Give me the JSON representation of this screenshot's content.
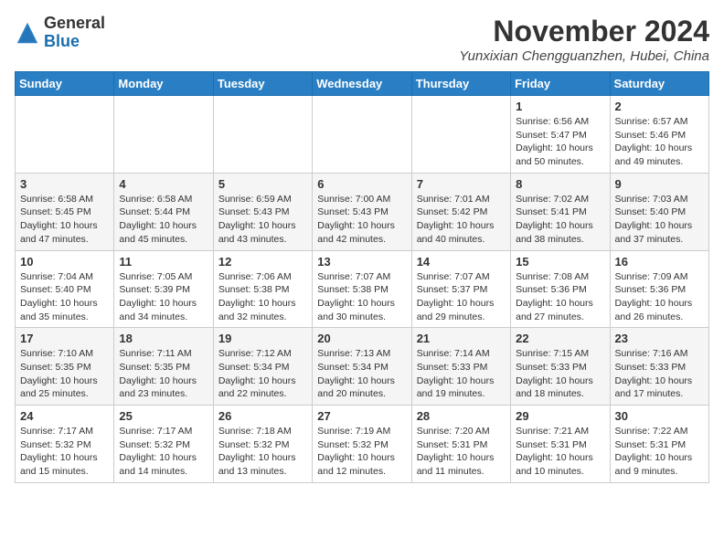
{
  "header": {
    "logo_line1": "General",
    "logo_line2": "Blue",
    "month_year": "November 2024",
    "location": "Yunxixian Chengguanzhen, Hubei, China"
  },
  "days_of_week": [
    "Sunday",
    "Monday",
    "Tuesday",
    "Wednesday",
    "Thursday",
    "Friday",
    "Saturday"
  ],
  "weeks": [
    [
      {
        "day": "",
        "info": ""
      },
      {
        "day": "",
        "info": ""
      },
      {
        "day": "",
        "info": ""
      },
      {
        "day": "",
        "info": ""
      },
      {
        "day": "",
        "info": ""
      },
      {
        "day": "1",
        "info": "Sunrise: 6:56 AM\nSunset: 5:47 PM\nDaylight: 10 hours\nand 50 minutes."
      },
      {
        "day": "2",
        "info": "Sunrise: 6:57 AM\nSunset: 5:46 PM\nDaylight: 10 hours\nand 49 minutes."
      }
    ],
    [
      {
        "day": "3",
        "info": "Sunrise: 6:58 AM\nSunset: 5:45 PM\nDaylight: 10 hours\nand 47 minutes."
      },
      {
        "day": "4",
        "info": "Sunrise: 6:58 AM\nSunset: 5:44 PM\nDaylight: 10 hours\nand 45 minutes."
      },
      {
        "day": "5",
        "info": "Sunrise: 6:59 AM\nSunset: 5:43 PM\nDaylight: 10 hours\nand 43 minutes."
      },
      {
        "day": "6",
        "info": "Sunrise: 7:00 AM\nSunset: 5:43 PM\nDaylight: 10 hours\nand 42 minutes."
      },
      {
        "day": "7",
        "info": "Sunrise: 7:01 AM\nSunset: 5:42 PM\nDaylight: 10 hours\nand 40 minutes."
      },
      {
        "day": "8",
        "info": "Sunrise: 7:02 AM\nSunset: 5:41 PM\nDaylight: 10 hours\nand 38 minutes."
      },
      {
        "day": "9",
        "info": "Sunrise: 7:03 AM\nSunset: 5:40 PM\nDaylight: 10 hours\nand 37 minutes."
      }
    ],
    [
      {
        "day": "10",
        "info": "Sunrise: 7:04 AM\nSunset: 5:40 PM\nDaylight: 10 hours\nand 35 minutes."
      },
      {
        "day": "11",
        "info": "Sunrise: 7:05 AM\nSunset: 5:39 PM\nDaylight: 10 hours\nand 34 minutes."
      },
      {
        "day": "12",
        "info": "Sunrise: 7:06 AM\nSunset: 5:38 PM\nDaylight: 10 hours\nand 32 minutes."
      },
      {
        "day": "13",
        "info": "Sunrise: 7:07 AM\nSunset: 5:38 PM\nDaylight: 10 hours\nand 30 minutes."
      },
      {
        "day": "14",
        "info": "Sunrise: 7:07 AM\nSunset: 5:37 PM\nDaylight: 10 hours\nand 29 minutes."
      },
      {
        "day": "15",
        "info": "Sunrise: 7:08 AM\nSunset: 5:36 PM\nDaylight: 10 hours\nand 27 minutes."
      },
      {
        "day": "16",
        "info": "Sunrise: 7:09 AM\nSunset: 5:36 PM\nDaylight: 10 hours\nand 26 minutes."
      }
    ],
    [
      {
        "day": "17",
        "info": "Sunrise: 7:10 AM\nSunset: 5:35 PM\nDaylight: 10 hours\nand 25 minutes."
      },
      {
        "day": "18",
        "info": "Sunrise: 7:11 AM\nSunset: 5:35 PM\nDaylight: 10 hours\nand 23 minutes."
      },
      {
        "day": "19",
        "info": "Sunrise: 7:12 AM\nSunset: 5:34 PM\nDaylight: 10 hours\nand 22 minutes."
      },
      {
        "day": "20",
        "info": "Sunrise: 7:13 AM\nSunset: 5:34 PM\nDaylight: 10 hours\nand 20 minutes."
      },
      {
        "day": "21",
        "info": "Sunrise: 7:14 AM\nSunset: 5:33 PM\nDaylight: 10 hours\nand 19 minutes."
      },
      {
        "day": "22",
        "info": "Sunrise: 7:15 AM\nSunset: 5:33 PM\nDaylight: 10 hours\nand 18 minutes."
      },
      {
        "day": "23",
        "info": "Sunrise: 7:16 AM\nSunset: 5:33 PM\nDaylight: 10 hours\nand 17 minutes."
      }
    ],
    [
      {
        "day": "24",
        "info": "Sunrise: 7:17 AM\nSunset: 5:32 PM\nDaylight: 10 hours\nand 15 minutes."
      },
      {
        "day": "25",
        "info": "Sunrise: 7:17 AM\nSunset: 5:32 PM\nDaylight: 10 hours\nand 14 minutes."
      },
      {
        "day": "26",
        "info": "Sunrise: 7:18 AM\nSunset: 5:32 PM\nDaylight: 10 hours\nand 13 minutes."
      },
      {
        "day": "27",
        "info": "Sunrise: 7:19 AM\nSunset: 5:32 PM\nDaylight: 10 hours\nand 12 minutes."
      },
      {
        "day": "28",
        "info": "Sunrise: 7:20 AM\nSunset: 5:31 PM\nDaylight: 10 hours\nand 11 minutes."
      },
      {
        "day": "29",
        "info": "Sunrise: 7:21 AM\nSunset: 5:31 PM\nDaylight: 10 hours\nand 10 minutes."
      },
      {
        "day": "30",
        "info": "Sunrise: 7:22 AM\nSunset: 5:31 PM\nDaylight: 10 hours\nand 9 minutes."
      }
    ]
  ]
}
